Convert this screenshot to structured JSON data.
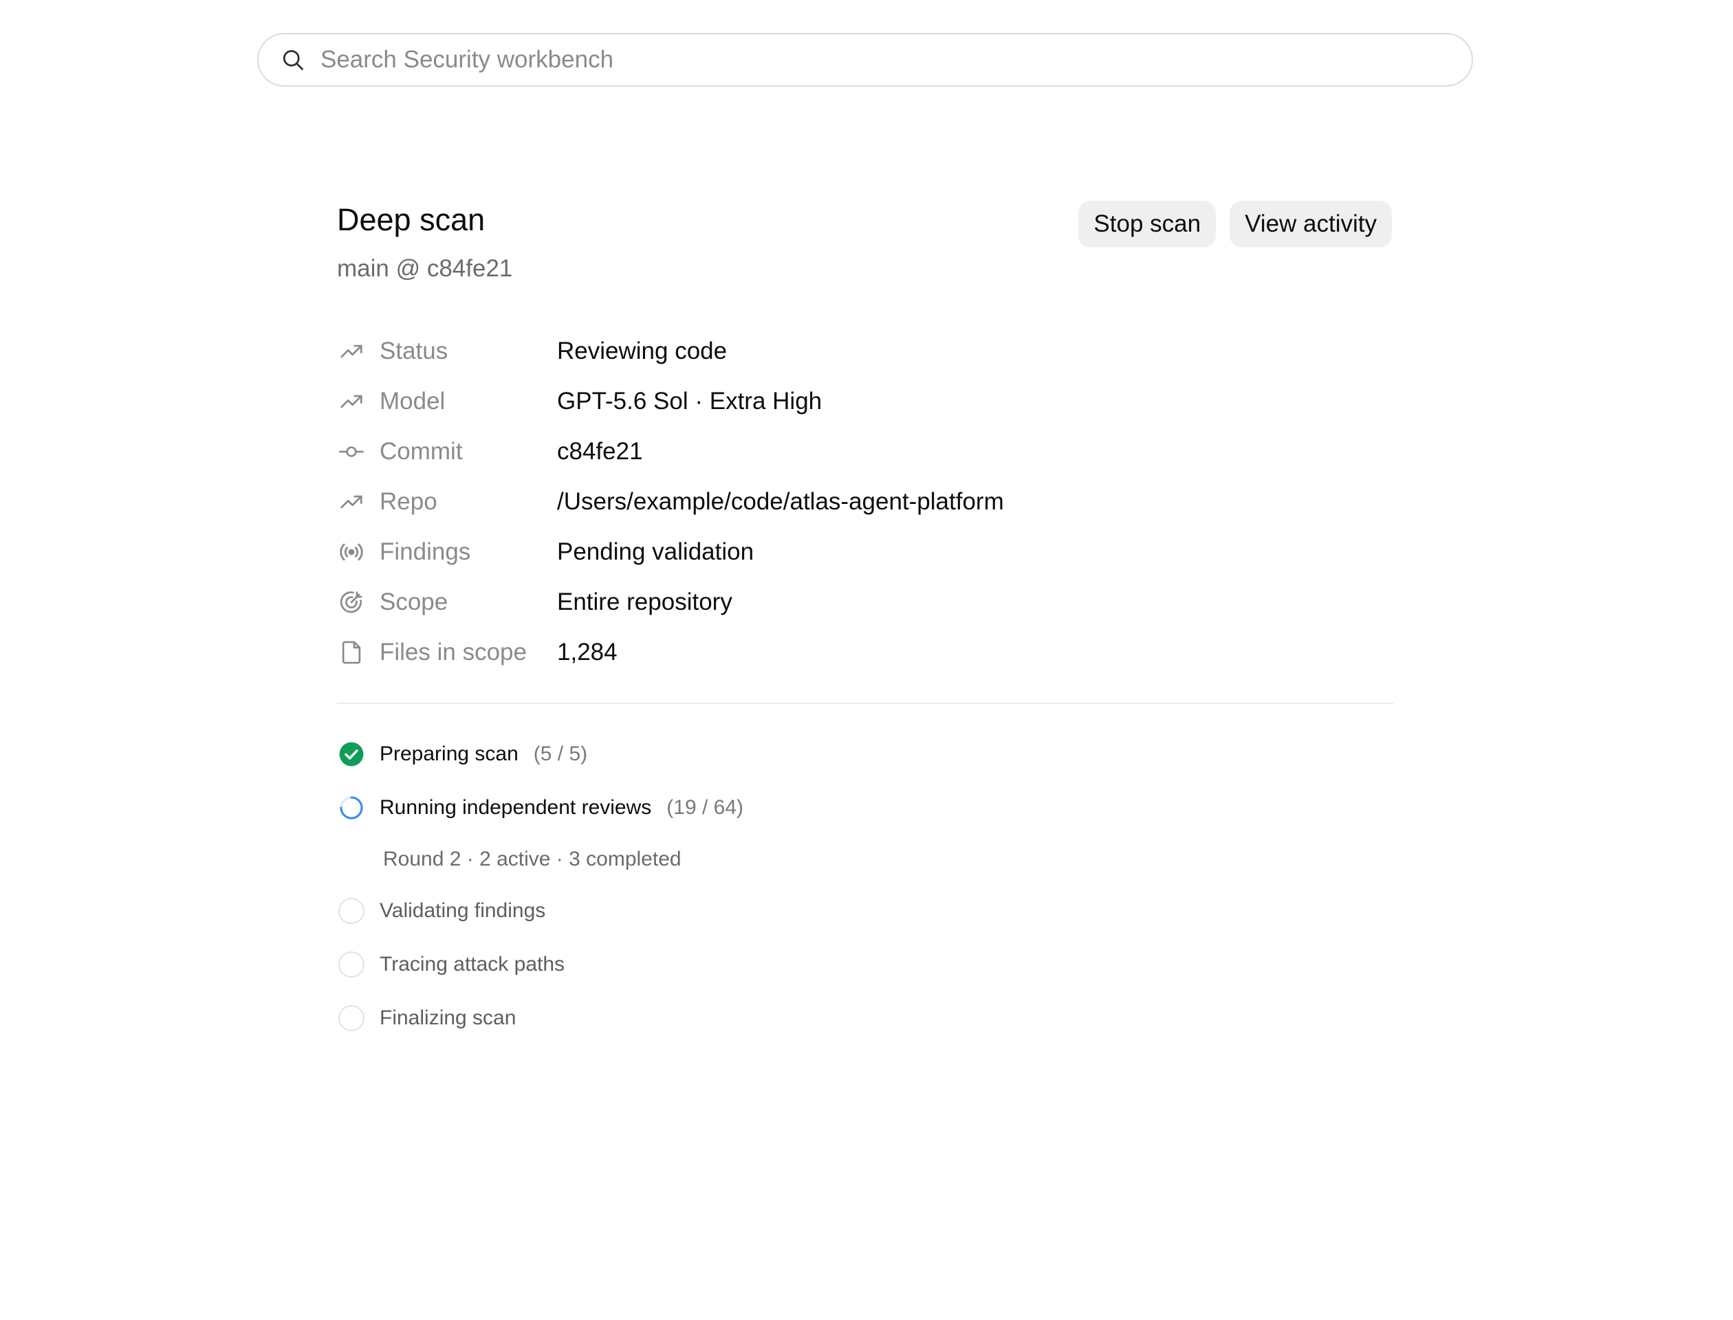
{
  "search": {
    "placeholder": "Search Security workbench",
    "icon": "search-icon"
  },
  "header": {
    "title": "Deep scan",
    "subtitle": "main @ c84fe21",
    "actions": {
      "stop_label": "Stop scan",
      "activity_label": "View activity"
    }
  },
  "details": [
    {
      "icon": "trend-up-icon",
      "label": "Status",
      "value": "Reviewing code"
    },
    {
      "icon": "trend-up-icon",
      "label": "Model",
      "value": "GPT-5.6 Sol · Extra High"
    },
    {
      "icon": "commit-icon",
      "label": "Commit",
      "value": "c84fe21"
    },
    {
      "icon": "trend-up-icon",
      "label": "Repo",
      "value": "/Users/example/code/atlas-agent-platform"
    },
    {
      "icon": "broadcast-icon",
      "label": "Findings",
      "value": "Pending validation"
    },
    {
      "icon": "target-icon",
      "label": "Scope",
      "value": "Entire repository"
    },
    {
      "icon": "file-icon",
      "label": "Files in scope",
      "value": "1,284"
    }
  ],
  "progress": {
    "steps": [
      {
        "state": "complete",
        "icon": "check-circle-icon",
        "label": "Preparing scan",
        "count": "(5 / 5)"
      },
      {
        "state": "running",
        "icon": "spinner-icon",
        "label": "Running independent reviews",
        "count": "(19 / 64)",
        "detail": "Round 2 · 2 active · 3 completed"
      },
      {
        "state": "pending",
        "icon": "empty-circle-icon",
        "label": "Validating findings"
      },
      {
        "state": "pending",
        "icon": "empty-circle-icon",
        "label": "Tracing attack paths"
      },
      {
        "state": "pending",
        "icon": "empty-circle-icon",
        "label": "Finalizing scan"
      }
    ]
  },
  "colors": {
    "success": "#0f9d58",
    "spinner": "#3b8ff0",
    "muted_text": "#8a8a8a",
    "button_bg": "#efefef"
  }
}
